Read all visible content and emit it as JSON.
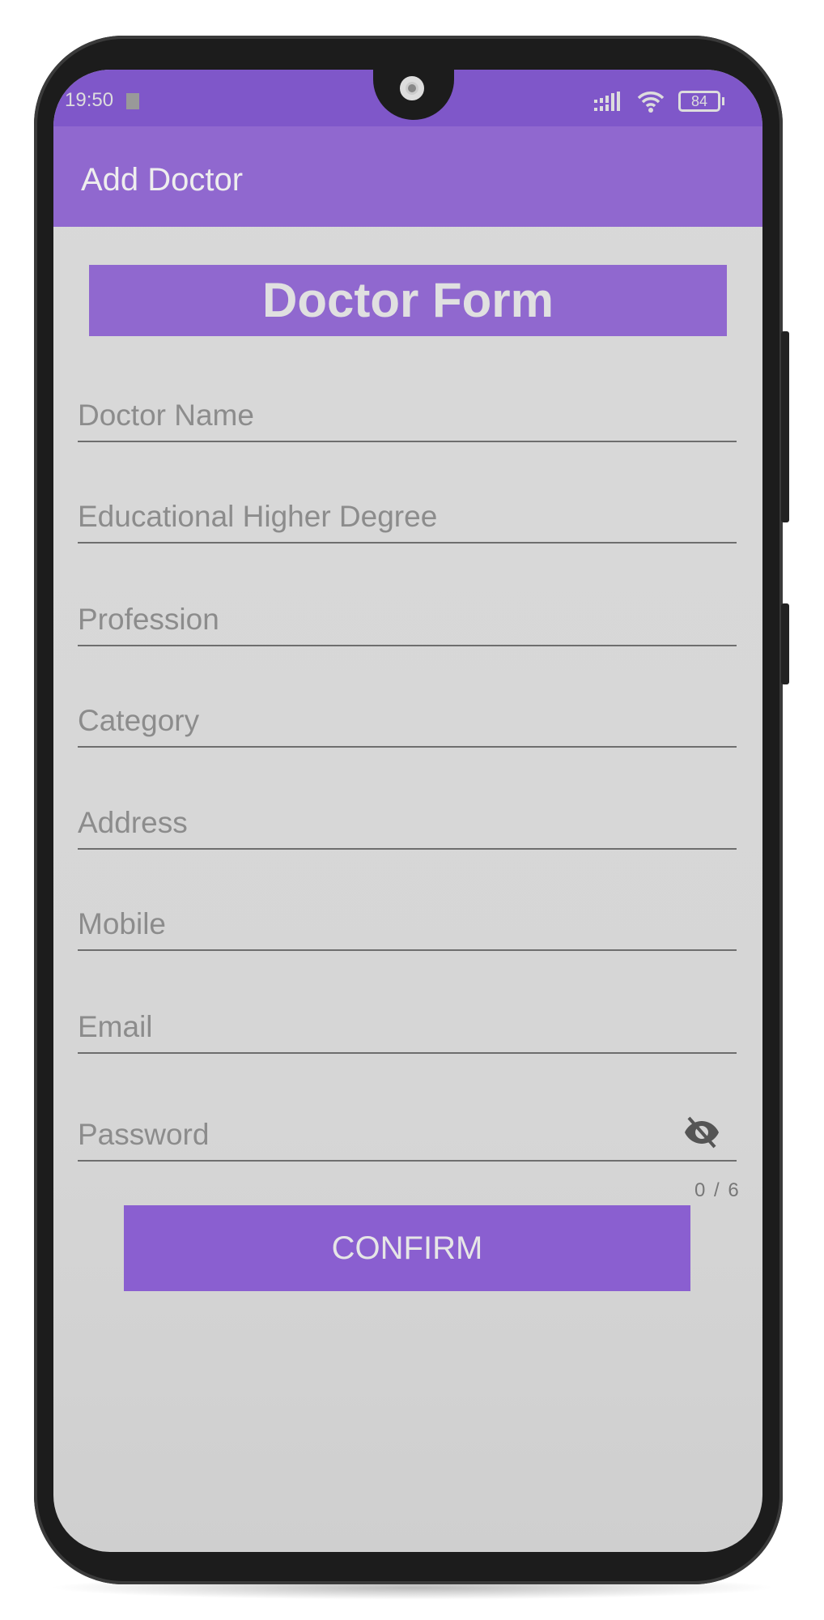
{
  "status_bar": {
    "time": "19:50",
    "battery": "84"
  },
  "app_bar": {
    "title": "Add Doctor"
  },
  "form": {
    "heading": "Doctor Form",
    "fields": [
      {
        "placeholder": "Doctor Name"
      },
      {
        "placeholder": "Educational Higher Degree"
      },
      {
        "placeholder": "Profession"
      },
      {
        "placeholder": "Category"
      },
      {
        "placeholder": "Address"
      },
      {
        "placeholder": "Mobile"
      },
      {
        "placeholder": "Email"
      },
      {
        "placeholder": "Password"
      }
    ],
    "password_counter": "0 / 6",
    "confirm_label": "CONFIRM"
  },
  "colors": {
    "primary": "#7f57c9",
    "appbar": "#9068cf",
    "button": "#8a5fd0"
  }
}
